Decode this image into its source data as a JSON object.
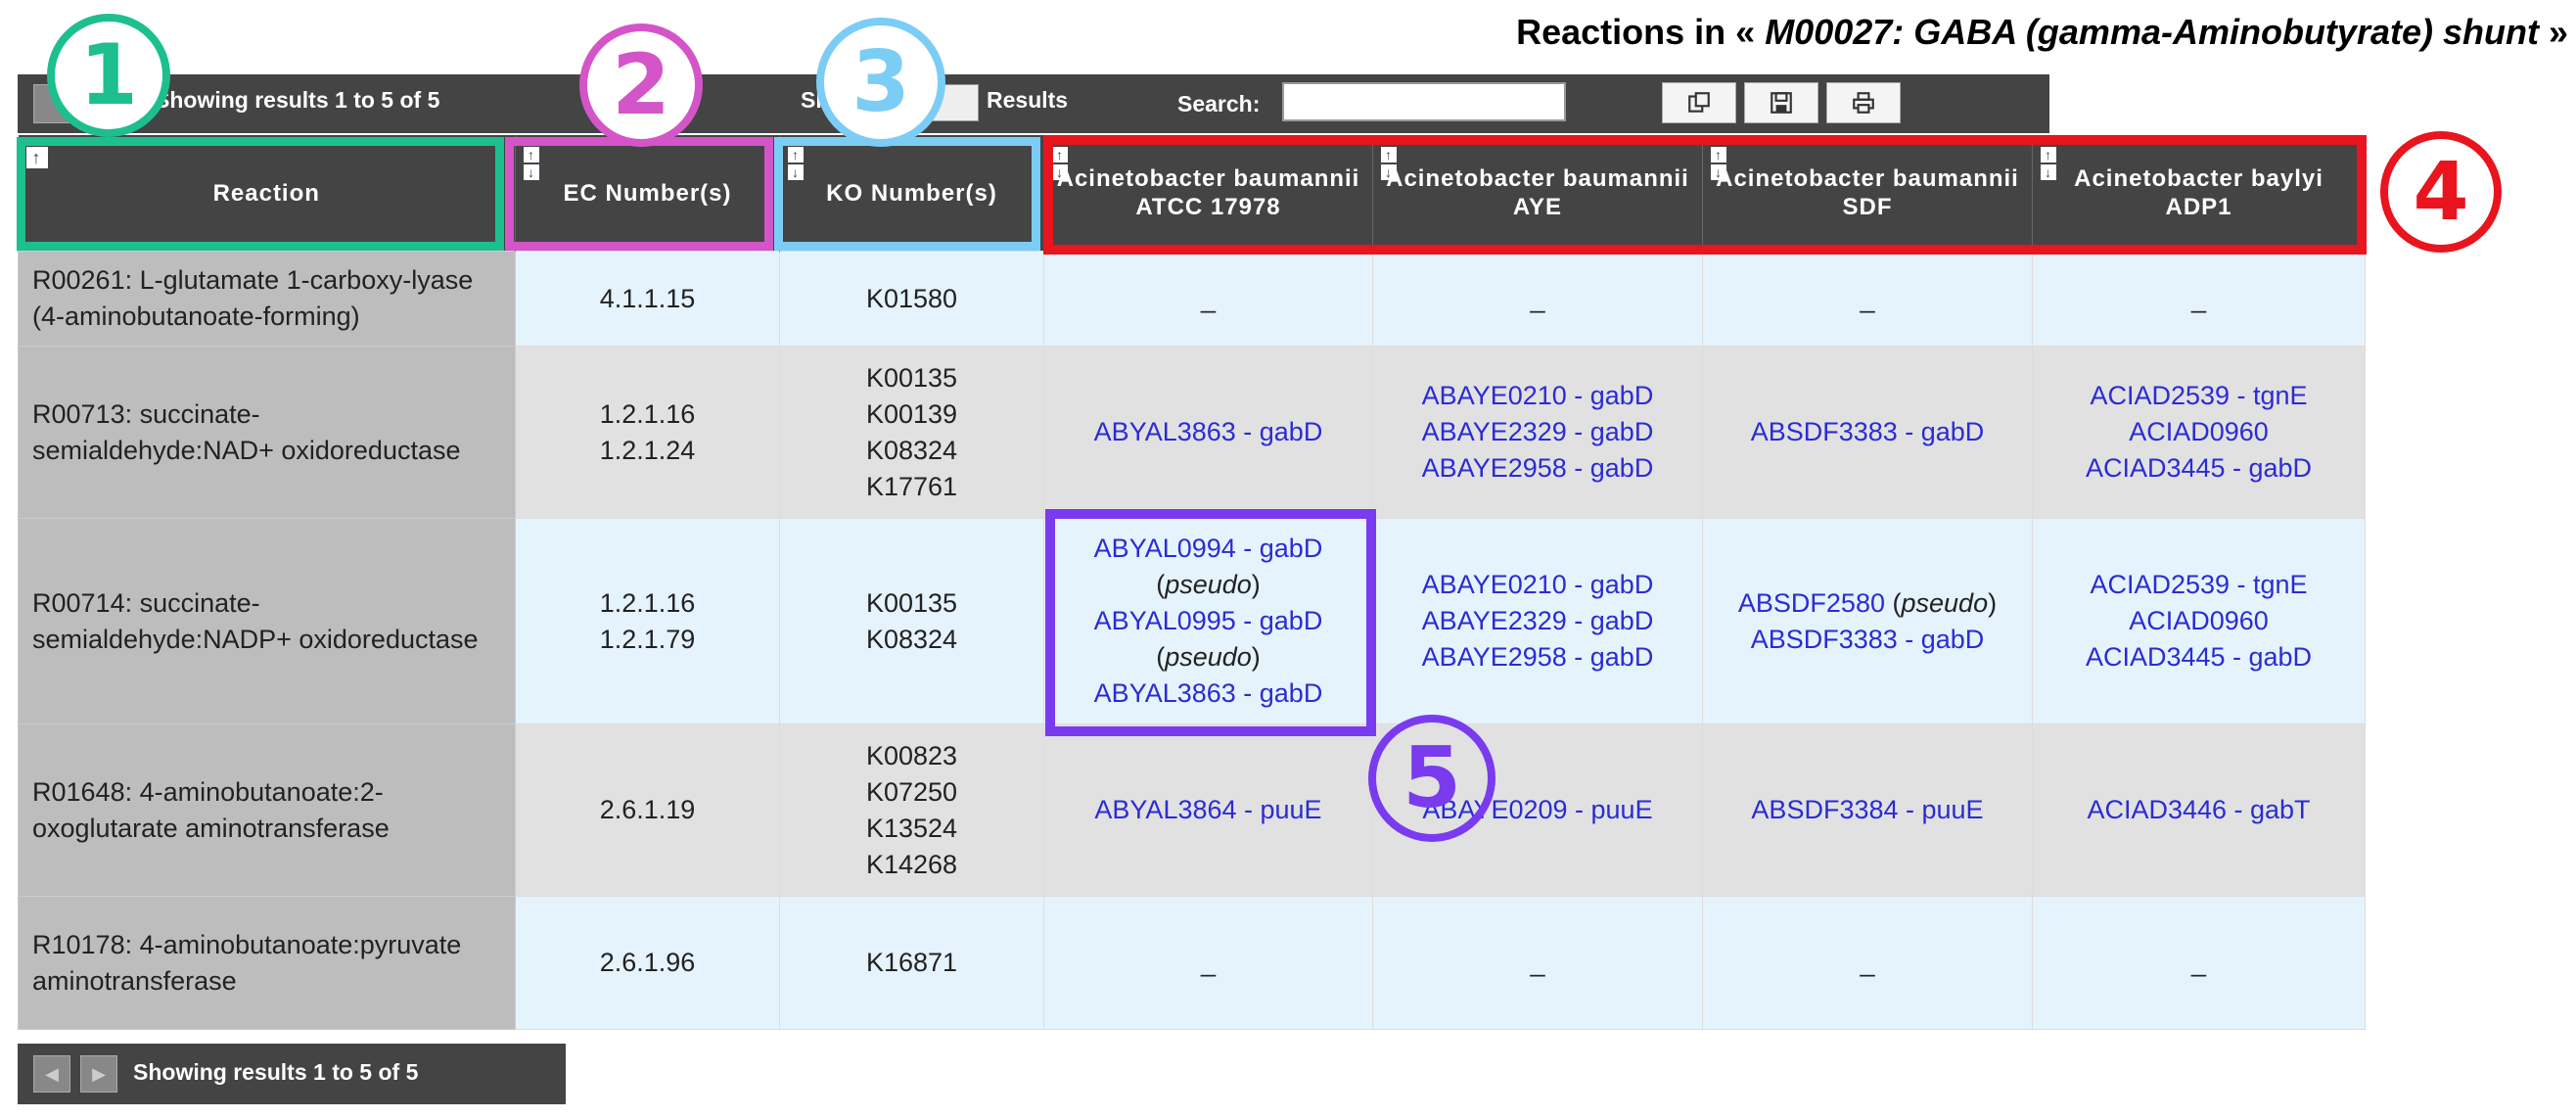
{
  "title": {
    "prefix": "Reactions in « ",
    "module": "M00027: GABA (gamma-Aminobutyrate) shunt",
    "suffix": " »"
  },
  "toolbar": {
    "pager_text": "Showing results 1 to 5 of 5",
    "show_label": "Show",
    "results_label": "Results",
    "search_label": "Search:",
    "search_value": "",
    "copy_icon": "copy-icon",
    "save_icon": "save-icon",
    "print_icon": "print-icon"
  },
  "columns": [
    "Reaction",
    "EC Number(s)",
    "KO Number(s)",
    "Acinetobacter baumannii ATCC 17978",
    "Acinetobacter baumannii AYE",
    "Acinetobacter baumannii SDF",
    "Acinetobacter baylyi ADP1"
  ],
  "rows": [
    {
      "reaction": "R00261: L-glutamate 1-carboxy-lyase (4-aminobutanoate-forming)",
      "ec": "4.1.1.15",
      "ko": "K01580",
      "g1": "_",
      "g2": "_",
      "g3": "_",
      "g4": "_"
    },
    {
      "reaction": "R00713: succinate-semialdehyde:NAD+ oxidoreductase",
      "ec": [
        "1.2.1.16",
        "1.2.1.24"
      ],
      "ko": [
        "K00135",
        "K00139",
        "K08324",
        "K17761"
      ],
      "g1": "ABYAL3863 - gabD",
      "g2": [
        "ABAYE0210 - gabD",
        "ABAYE2329 - gabD",
        "ABAYE2958 - gabD"
      ],
      "g3": "ABSDF3383 - gabD",
      "g4": [
        "ACIAD2539 - tgnE",
        "ACIAD0960",
        "ACIAD3445 - gabD"
      ]
    },
    {
      "reaction": "R00714: succinate-semialdehyde:NADP+ oxidoreductase",
      "ec": [
        "1.2.1.16",
        "1.2.1.79"
      ],
      "ko": [
        "K00135",
        "K08324"
      ],
      "g1": [
        "ABYAL0994 - gabD",
        "ABYAL0995 - gabD",
        "ABYAL3863 - gabD"
      ],
      "g2": [
        "ABAYE0210 - gabD",
        "ABAYE2329 - gabD",
        "ABAYE2958 - gabD"
      ],
      "g3": [
        "ABSDF2580",
        "ABSDF3383 - gabD"
      ],
      "g4": [
        "ACIAD2539 - tgnE",
        "ACIAD0960",
        "ACIAD3445 - gabD"
      ],
      "pseudo_label": "pseudo"
    },
    {
      "reaction": "R01648: 4-aminobutanoate:2-oxoglutarate aminotransferase",
      "ec": "2.6.1.19",
      "ko": [
        "K00823",
        "K07250",
        "K13524",
        "K14268"
      ],
      "g1": "ABYAL3864 - puuE",
      "g2": "ABAYE0209 - puuE",
      "g3": "ABSDF3384 - puuE",
      "g4": "ACIAD3446 - gabT"
    },
    {
      "reaction": "R10178: 4-aminobutanoate:pyruvate aminotransferase",
      "ec": "2.6.1.96",
      "ko": "K16871",
      "g1": "_",
      "g2": "_",
      "g3": "_",
      "g4": "_"
    }
  ],
  "footer": {
    "pager_text": "Showing results 1 to 5 of 5"
  },
  "markers": [
    "1",
    "2",
    "3",
    "4",
    "5"
  ],
  "colors": {
    "marker1": "#1dbf8e",
    "marker2": "#d455c8",
    "marker3": "#7ccdf5",
    "marker4": "#e8141e",
    "marker5": "#7a3bef",
    "gene_link": "#2b2bd6",
    "header_bg": "#444444"
  }
}
